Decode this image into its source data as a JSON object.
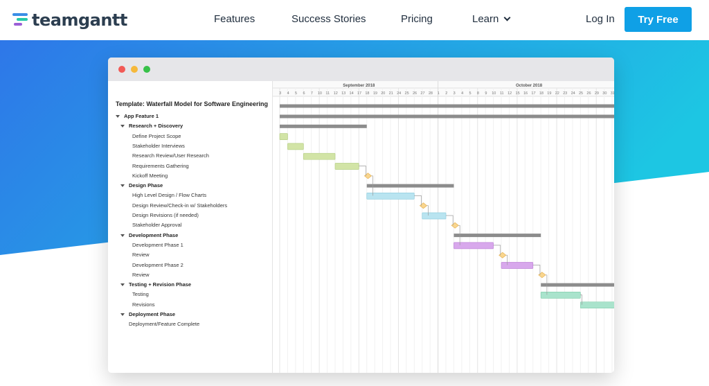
{
  "nav": {
    "logo_part1": "team",
    "logo_part2": "gantt",
    "links": [
      "Features",
      "Success Stories",
      "Pricing",
      "Learn"
    ],
    "login": "Log In",
    "cta": "Try Free"
  },
  "colors": {
    "cta": "#0fa0e6",
    "hero_blue": "#2f7fe6",
    "hero_cyan": "#1ec4e4",
    "summary_bar": "#8c8c8c",
    "research": "#d2e4a6",
    "design": "#b9e4f0",
    "development": "#d8a8ec",
    "testing": "#a9e3cc",
    "milestone": "#f9d68f"
  },
  "project": {
    "title": "Template: Waterfall Model for Software Engineering",
    "tasks": [
      {
        "label": "App Feature 1",
        "type": "group",
        "level": 0
      },
      {
        "label": "Research + Discovery",
        "type": "group",
        "level": 1
      },
      {
        "label": "Define Project Scope",
        "type": "task",
        "level": 2
      },
      {
        "label": "Stakeholder Interviews",
        "type": "task",
        "level": 2
      },
      {
        "label": "Research Review/User Research",
        "type": "task",
        "level": 2
      },
      {
        "label": "Requirements Gathering",
        "type": "task",
        "level": 2
      },
      {
        "label": "Kickoff Meeting",
        "type": "task",
        "level": 2
      },
      {
        "label": "Design Phase",
        "type": "group",
        "level": 1
      },
      {
        "label": "High Level Design / Flow Charts",
        "type": "task",
        "level": 2
      },
      {
        "label": "Design Review/Check-in w/ Stakeholders",
        "type": "task",
        "level": 2
      },
      {
        "label": "Design Revisions (if needed)",
        "type": "task",
        "level": 2
      },
      {
        "label": "Stakeholder Approval",
        "type": "task",
        "level": 2
      },
      {
        "label": "Development Phase",
        "type": "group",
        "level": 1
      },
      {
        "label": "Development Phase 1",
        "type": "task",
        "level": 2
      },
      {
        "label": "Review",
        "type": "task",
        "level": 2
      },
      {
        "label": "Development Phase 2",
        "type": "task",
        "level": 2
      },
      {
        "label": "Review",
        "type": "task",
        "level": 2
      },
      {
        "label": "Testing + Revision Phase",
        "type": "group",
        "level": 1
      },
      {
        "label": "Testing",
        "type": "task",
        "level": 2
      },
      {
        "label": "Revisions",
        "type": "task",
        "level": 2
      },
      {
        "label": "Deployment Phase",
        "type": "group",
        "level": 1
      },
      {
        "label": "Deployment/Feature Complete",
        "type": "task",
        "level": 1
      }
    ]
  },
  "timeline": {
    "months": [
      "September 2018",
      "October 2018"
    ],
    "days": [
      "3",
      "4",
      "5",
      "6",
      "7",
      "10",
      "11",
      "12",
      "13",
      "14",
      "17",
      "18",
      "19",
      "20",
      "21",
      "24",
      "25",
      "26",
      "27",
      "28",
      "1",
      "2",
      "3",
      "4",
      "5",
      "8",
      "9",
      "10",
      "11",
      "12",
      "15",
      "16",
      "17",
      "18",
      "19",
      "22",
      "23",
      "24",
      "25",
      "26",
      "29",
      "30",
      "31"
    ]
  },
  "bars": [
    {
      "row": -1,
      "start": 0,
      "end": 42,
      "kind": "summary"
    },
    {
      "row": 0,
      "start": 0,
      "end": 42,
      "kind": "summary"
    },
    {
      "row": 1,
      "start": 0,
      "end": 11,
      "kind": "summary"
    },
    {
      "row": 2,
      "start": 0,
      "end": 1,
      "kind": "research"
    },
    {
      "row": 3,
      "start": 1,
      "end": 3,
      "kind": "research"
    },
    {
      "row": 4,
      "start": 3,
      "end": 7,
      "kind": "research"
    },
    {
      "row": 5,
      "start": 7,
      "end": 10,
      "kind": "research"
    },
    {
      "row": 6,
      "start": 11,
      "kind": "milestone"
    },
    {
      "row": 7,
      "start": 11,
      "end": 22,
      "kind": "summary"
    },
    {
      "row": 8,
      "start": 11,
      "end": 17,
      "kind": "design"
    },
    {
      "row": 9,
      "start": 18,
      "kind": "milestone"
    },
    {
      "row": 10,
      "start": 18,
      "end": 21,
      "kind": "design"
    },
    {
      "row": 11,
      "start": 22,
      "kind": "milestone"
    },
    {
      "row": 12,
      "start": 22,
      "end": 33,
      "kind": "summary"
    },
    {
      "row": 13,
      "start": 22,
      "end": 27,
      "kind": "development"
    },
    {
      "row": 14,
      "start": 28,
      "kind": "milestone"
    },
    {
      "row": 15,
      "start": 28,
      "end": 32,
      "kind": "development"
    },
    {
      "row": 16,
      "start": 33,
      "kind": "milestone"
    },
    {
      "row": 17,
      "start": 33,
      "end": 42,
      "kind": "summary"
    },
    {
      "row": 18,
      "start": 33,
      "end": 38,
      "kind": "testing"
    },
    {
      "row": 19,
      "start": 38,
      "end": 42,
      "kind": "testing"
    }
  ]
}
